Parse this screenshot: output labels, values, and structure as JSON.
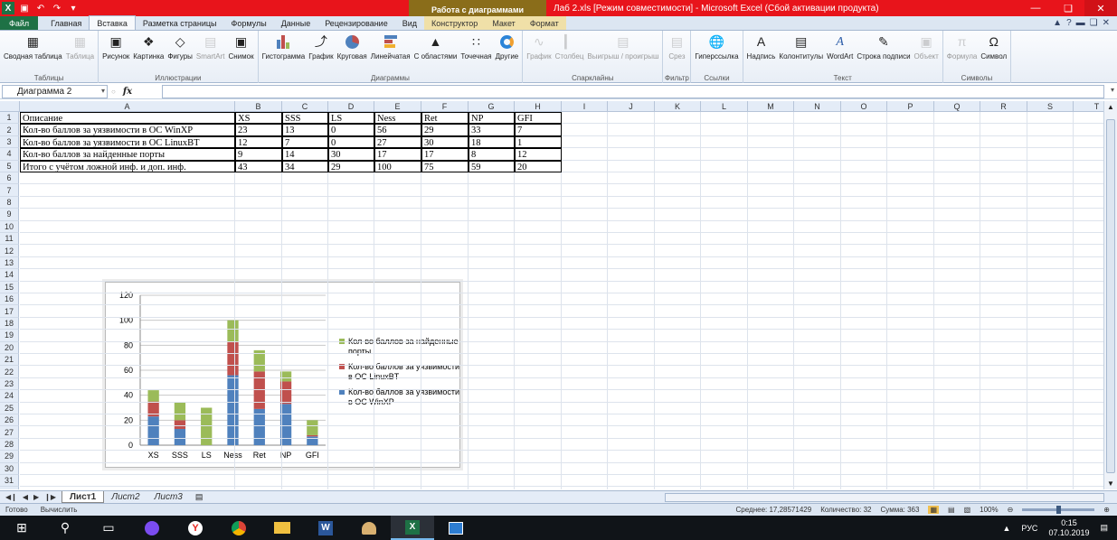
{
  "window": {
    "context_tab": "Работа с диаграммами",
    "title": "Лаб 2.xls  [Режим совместимости]  -  Microsoft Excel (Сбой активации продукта)"
  },
  "tabs": [
    {
      "label": "Файл",
      "kind": "file"
    },
    {
      "label": "Главная",
      "kind": ""
    },
    {
      "label": "Вставка",
      "kind": "active"
    },
    {
      "label": "Разметка страницы",
      "kind": ""
    },
    {
      "label": "Формулы",
      "kind": ""
    },
    {
      "label": "Данные",
      "kind": ""
    },
    {
      "label": "Рецензирование",
      "kind": ""
    },
    {
      "label": "Вид",
      "kind": ""
    },
    {
      "label": "Конструктор",
      "kind": "ctx"
    },
    {
      "label": "Макет",
      "kind": "ctx"
    },
    {
      "label": "Формат",
      "kind": "ctx"
    }
  ],
  "ribbon": {
    "groups": [
      {
        "label": "Таблицы",
        "buttons": [
          {
            "label": "Сводная таблица",
            "icon": "pivot-icon",
            "disabled": false
          },
          {
            "label": "Таблица",
            "icon": "table-icon",
            "disabled": true
          }
        ]
      },
      {
        "label": "Иллюстрации",
        "buttons": [
          {
            "label": "Рисунок",
            "icon": "picture-icon",
            "disabled": false
          },
          {
            "label": "Картинка",
            "icon": "clipart-icon",
            "disabled": false
          },
          {
            "label": "Фигуры",
            "icon": "shapes-icon",
            "disabled": false
          },
          {
            "label": "SmartArt",
            "icon": "smartart-icon",
            "disabled": true
          },
          {
            "label": "Снимок",
            "icon": "screenshot-icon",
            "disabled": false
          }
        ]
      },
      {
        "label": "Диаграммы",
        "buttons": [
          {
            "label": "Гистограмма",
            "icon": "column-chart-icon",
            "disabled": false
          },
          {
            "label": "График",
            "icon": "line-chart-icon",
            "disabled": false
          },
          {
            "label": "Круговая",
            "icon": "pie-chart-icon",
            "disabled": false
          },
          {
            "label": "Линейчатая",
            "icon": "bar-chart-icon",
            "disabled": false
          },
          {
            "label": "С областями",
            "icon": "area-chart-icon",
            "disabled": false
          },
          {
            "label": "Точечная",
            "icon": "scatter-chart-icon",
            "disabled": false
          },
          {
            "label": "Другие",
            "icon": "other-chart-icon",
            "disabled": false
          }
        ]
      },
      {
        "label": "Спарклайны",
        "buttons": [
          {
            "label": "График",
            "icon": "sparkline-line-icon",
            "disabled": true
          },
          {
            "label": "Столбец",
            "icon": "sparkline-column-icon",
            "disabled": true
          },
          {
            "label": "Выигрыш / проигрыш",
            "icon": "sparkline-winloss-icon",
            "disabled": true
          }
        ]
      },
      {
        "label": "Фильтр",
        "buttons": [
          {
            "label": "Срез",
            "icon": "slicer-icon",
            "disabled": true
          }
        ]
      },
      {
        "label": "Ссылки",
        "buttons": [
          {
            "label": "Гиперссылка",
            "icon": "hyperlink-icon",
            "disabled": false
          }
        ]
      },
      {
        "label": "Текст",
        "buttons": [
          {
            "label": "Надпись",
            "icon": "textbox-icon",
            "disabled": false
          },
          {
            "label": "Колонтитулы",
            "icon": "header-footer-icon",
            "disabled": false
          },
          {
            "label": "WordArt",
            "icon": "wordart-icon",
            "disabled": false
          },
          {
            "label": "Строка подписи",
            "icon": "signature-icon",
            "disabled": false
          },
          {
            "label": "Объект",
            "icon": "object-icon",
            "disabled": true
          }
        ]
      },
      {
        "label": "Символы",
        "buttons": [
          {
            "label": "Формула",
            "icon": "equation-icon",
            "disabled": true
          },
          {
            "label": "Символ",
            "icon": "symbol-icon",
            "disabled": false
          }
        ]
      }
    ]
  },
  "formula_bar": {
    "name_box": "Диаграмма 2",
    "formula": ""
  },
  "columns": [
    "A",
    "B",
    "C",
    "D",
    "E",
    "F",
    "G",
    "H",
    "I",
    "J",
    "K",
    "L",
    "M",
    "N",
    "O",
    "P",
    "Q",
    "R",
    "S",
    "T"
  ],
  "rows": [
    [
      "Описание",
      "XS",
      "SSS",
      "LS",
      "Ness",
      "Ret",
      "NP",
      "GFI"
    ],
    [
      "Кол-во баллов за уязвимости в ОС WinXP",
      "23",
      "13",
      "0",
      "56",
      "29",
      "33",
      "7"
    ],
    [
      "Кол-во баллов за уязвимости в ОС LinuxBT",
      "12",
      "7",
      "0",
      "27",
      "30",
      "18",
      "1"
    ],
    [
      "Кол-во баллов за найденные порты",
      "9",
      "14",
      "30",
      "17",
      "17",
      "8",
      "12"
    ],
    [
      "Итого с учётом ложной инф. и доп. инф.",
      "43",
      "34",
      "29",
      "100",
      "75",
      "59",
      "20"
    ]
  ],
  "chart_data": {
    "type": "bar",
    "stacked": true,
    "categories": [
      "XS",
      "SSS",
      "LS",
      "Ness",
      "Ret",
      "NP",
      "GFI"
    ],
    "series": [
      {
        "name": "Кол-во баллов за уязвимости в ОС WinXP",
        "values": [
          23,
          13,
          0,
          56,
          29,
          33,
          7
        ],
        "color": "#4f81bd"
      },
      {
        "name": "Кол-во баллов за уязвимости в ОС LinuxBT",
        "values": [
          12,
          7,
          0,
          27,
          30,
          18,
          1
        ],
        "color": "#c0504d"
      },
      {
        "name": "Кол-во баллов за найденные порты",
        "values": [
          9,
          14,
          30,
          17,
          17,
          8,
          12
        ],
        "color": "#9bbb59"
      }
    ],
    "yticks": [
      "0",
      "20",
      "40",
      "60",
      "80",
      "100",
      "120"
    ],
    "ylim": [
      0,
      120
    ],
    "grid": true,
    "legend": "right"
  },
  "sheets": [
    {
      "label": "Лист1",
      "active": true
    },
    {
      "label": "Лист2",
      "active": false
    },
    {
      "label": "Лист3",
      "active": false
    }
  ],
  "status": {
    "mode": "Готово",
    "calc": "Вычислить",
    "average": "Среднее: 17,28571429",
    "count": "Количество: 32",
    "sum": "Сумма: 363",
    "zoom": "100%"
  },
  "taskbar": {
    "lang": "РУС",
    "time": "0:15",
    "date": "07.10.2019"
  }
}
